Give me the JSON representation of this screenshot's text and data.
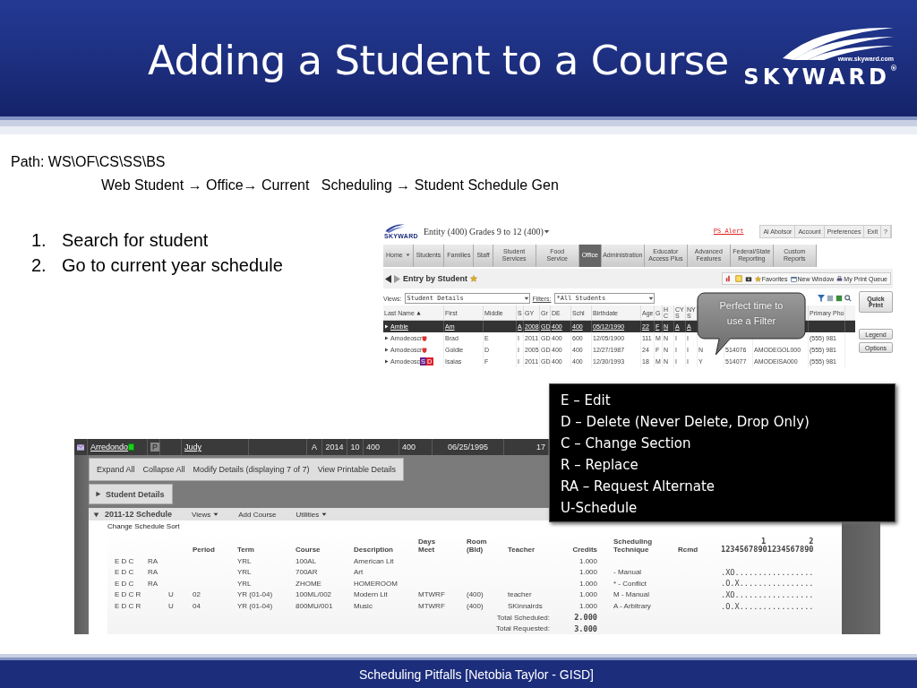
{
  "slide": {
    "title": "Adding a Student to a Course",
    "logo": {
      "url": "www.skyward.com",
      "name": "SKYWARD$^{®}$"
    },
    "path": {
      "label": "Path: WS\\OF\\CS\\SS\\BS",
      "trail": "Web Student → Office→ Current   Scheduling → Student Schedule Gen"
    },
    "steps": [
      {
        "marker": "1.",
        "text": "Search for student"
      },
      {
        "marker": "2.",
        "text": "Go to current year schedule"
      }
    ],
    "footer": "Scheduling Pitfalls [Netobia Taylor - GISD]"
  },
  "search_screen": {
    "logo": "SKYWARD",
    "entity": "Entity (400) Grades 9 to 12 (400)",
    "alert": "PS Alert",
    "top_links": [
      "Al Abotsor",
      "Account",
      "Preferences",
      "Exit",
      "?"
    ],
    "nav": [
      {
        "label": "Home",
        "kind": "split",
        "selected": false
      },
      {
        "label": "Students",
        "kind": "tab",
        "selected": false
      },
      {
        "label": "Families",
        "kind": "tab",
        "selected": false
      },
      {
        "label": "Staff",
        "kind": "tab",
        "selected": false
      },
      {
        "label": "Student Services",
        "kind": "tab",
        "selected": false
      },
      {
        "label": "Food Service",
        "kind": "tab",
        "selected": false
      },
      {
        "label": "Office",
        "kind": "tab",
        "selected": true
      },
      {
        "label": "Administration",
        "kind": "tab",
        "selected": false
      },
      {
        "label": "Educator Access Plus",
        "kind": "tab",
        "selected": false
      },
      {
        "label": "Advanced Features",
        "kind": "tab",
        "selected": false
      },
      {
        "label": "Federal/State Reporting",
        "kind": "tab",
        "selected": false
      },
      {
        "label": "Custom Reports",
        "kind": "tab",
        "selected": false
      }
    ],
    "page_title": "Entry by Student",
    "toolbar": [
      {
        "kind": "favorites",
        "label": "Favorites"
      },
      {
        "kind": "window",
        "label": "New Window"
      },
      {
        "kind": "print",
        "label": "My Print Queue"
      }
    ],
    "views": {
      "label": "Views:",
      "value": "Student Details"
    },
    "filters": {
      "label": "Filters:",
      "value": "*All Students"
    },
    "quick_print": "Quick Print",
    "side_buttons": [
      "Legend",
      "Options"
    ],
    "columns": [
      "Last Name",
      "First",
      "Middle",
      "S",
      "GY",
      "Gr",
      "DE",
      "Schl",
      "Birthdate",
      "Age",
      "G",
      "H C",
      "CY S",
      "NY S",
      null,
      null,
      null,
      "Primary Pho"
    ],
    "rows": [
      {
        "selected": true,
        "alert_icon": false,
        "cells": [
          "Amble",
          "Am",
          null,
          "A",
          "2008",
          "GD",
          "400",
          "400",
          "05/12/1990",
          "22",
          "F",
          "N",
          "A",
          "A",
          null,
          null,
          null,
          null
        ]
      },
      {
        "selected": false,
        "alert_icon": true,
        "cells": [
          "Amodeoscr",
          "Brad",
          "E",
          "I",
          "2011",
          "GD",
          "400",
          "600",
          "12/05/1900",
          "111",
          "M",
          "N",
          "I",
          "I",
          null,
          null,
          null,
          "(555) 981"
        ]
      },
      {
        "selected": false,
        "alert_icon": true,
        "cells": [
          "Amodeoscr",
          "Goldie",
          "D",
          "I",
          "2005",
          "GD",
          "400",
          "400",
          "12/27/1987",
          "24",
          "F",
          "N",
          "I",
          "I",
          "N",
          "514076",
          "AMODEGOL000",
          "(555) 981"
        ]
      },
      {
        "selected": false,
        "alert_icon": false,
        "badges": [
          {
            "label": "S",
            "color": "#6a1f8a"
          },
          {
            "label": "D",
            "color": "#e0202a"
          }
        ],
        "cells": [
          "Amodeosc",
          "Isaias",
          "F",
          "I",
          "2011",
          "GD",
          "400",
          "400",
          "12/30/1993",
          "18",
          "M",
          "N",
          "I",
          "I",
          "Y",
          "514077",
          "AMODEISA000",
          "(555) 981"
        ]
      }
    ],
    "callout": "Perfect time to use a Filter"
  },
  "schedule_screen": {
    "student": {
      "last_name": "Arredondo",
      "badge": "P",
      "first_name": "Judy",
      "cells": [
        "A",
        "2014",
        "10",
        "400",
        "400",
        "06/25/1995",
        "17"
      ]
    },
    "actions": [
      "Expand All",
      "Collapse All",
      "Modify Details (displaying 7 of 7)",
      "View Printable Details"
    ],
    "details_section": {
      "title": "Student Details",
      "expanded": false
    },
    "schedule_section": {
      "title": "2011-12 Schedule",
      "expanded": true,
      "menu": [
        {
          "label": "Views",
          "dropdown": true
        },
        {
          "label": "Add Course",
          "dropdown": false
        },
        {
          "label": "Utilities",
          "dropdown": true
        }
      ]
    },
    "sort_link": "Change Schedule Sort",
    "columns": [
      null,
      null,
      null,
      "Period",
      "Term",
      "Course",
      "Description",
      "Days\nMeet",
      "Room\n(Bld)",
      "Teacher",
      "Credits",
      "Scheduling\nTechnique",
      "Rcmd"
    ],
    "ruler": {
      "marks": [
        "1",
        "2"
      ],
      "digits": "12345678901234567890"
    },
    "rows": [
      [
        "E D C",
        "RA",
        null,
        null,
        "YRL",
        "100AL",
        "American Lit",
        null,
        null,
        null,
        "1.000",
        null,
        null,
        null
      ],
      [
        "E D C",
        "RA",
        null,
        null,
        "YRL",
        "700AR",
        "Art",
        null,
        null,
        null,
        "1.000",
        "- Manual",
        null,
        ".XO................."
      ],
      [
        "E D C",
        "RA",
        null,
        null,
        "YRL",
        "ZHOME",
        "HOMEROOM",
        null,
        null,
        null,
        "1.000",
        "* - Conflict",
        null,
        ".O.X................"
      ],
      [
        "E D C R",
        null,
        "U",
        "02",
        "YR (01-04)",
        "100ML/002",
        "Modern Lit",
        "MTWRF",
        "(400)",
        "teacher",
        "1.000",
        "M - Manual",
        null,
        ".XO................."
      ],
      [
        "E D C R",
        null,
        "U",
        "04",
        "YR (01-04)",
        "800MU/001",
        "Music",
        "MTWRF",
        "(400)",
        "SKinnairds",
        "1.000",
        "A - Arbitrary",
        null,
        ".O.X................"
      ]
    ],
    "totals": [
      {
        "label": "Total Scheduled:",
        "value": "2.000"
      },
      {
        "label": "Total Requested:",
        "value": "3.000"
      }
    ]
  },
  "legend_box": [
    "E – Edit",
    "D – Delete (Never Delete, Drop Only)",
    "C – Change Section",
    "R – Replace",
    "RA – Request Alternate",
    "U-Schedule"
  ]
}
